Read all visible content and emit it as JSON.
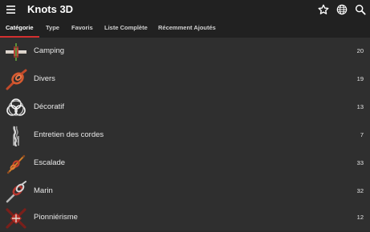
{
  "app": {
    "title": "Knots 3D",
    "actions": [
      "star-icon",
      "globe-icon",
      "search-icon"
    ]
  },
  "tabs": [
    {
      "label": "Catégorie",
      "active": true
    },
    {
      "label": "Type",
      "active": false
    },
    {
      "label": "Favoris",
      "active": false
    },
    {
      "label": "Liste Complète",
      "active": false
    },
    {
      "label": "Récemment Ajoutés",
      "active": false
    }
  ],
  "categories": [
    {
      "label": "Camping",
      "count": "20",
      "icon": "camping-knot-icon"
    },
    {
      "label": "Divers",
      "count": "19",
      "icon": "divers-knot-icon"
    },
    {
      "label": "Décoratif",
      "count": "13",
      "icon": "decoratif-knot-icon"
    },
    {
      "label": "Entretien des cordes",
      "count": "7",
      "icon": "entretien-knot-icon"
    },
    {
      "label": "Escalade",
      "count": "33",
      "icon": "escalade-knot-icon"
    },
    {
      "label": "Marin",
      "count": "32",
      "icon": "marin-knot-icon"
    },
    {
      "label": "Pionniérisme",
      "count": "12",
      "icon": "pionnierisme-knot-icon"
    }
  ],
  "colors": {
    "appbar": "#212121",
    "background": "#2f2f2f",
    "tab_indicator": "#d32f2f"
  }
}
